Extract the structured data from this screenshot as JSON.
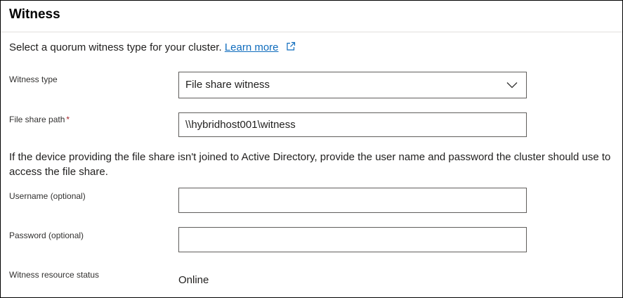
{
  "section": {
    "title": "Witness"
  },
  "intro": {
    "text": "Select a quorum witness type for your cluster.",
    "learn_more": "Learn more",
    "external_icon": "external-link-icon"
  },
  "fields": {
    "witness_type": {
      "label": "Witness type",
      "value": "File share witness",
      "icon": "chevron-down-icon"
    },
    "file_share_path": {
      "label": "File share path",
      "required_marker": "*",
      "value": "\\\\hybridhost001\\witness"
    },
    "explanation": "If the device providing the file share isn't joined to Active Directory, provide the user name and password the cluster should use to access the file share.",
    "username": {
      "label": "Username (optional)",
      "value": ""
    },
    "password": {
      "label": "Password (optional)",
      "value": ""
    },
    "status": {
      "label": "Witness resource status",
      "value": "Online"
    }
  },
  "colors": {
    "link": "#0f6cbd",
    "required": "#a4262c",
    "border": "#605e5c",
    "text": "#201f1e"
  }
}
